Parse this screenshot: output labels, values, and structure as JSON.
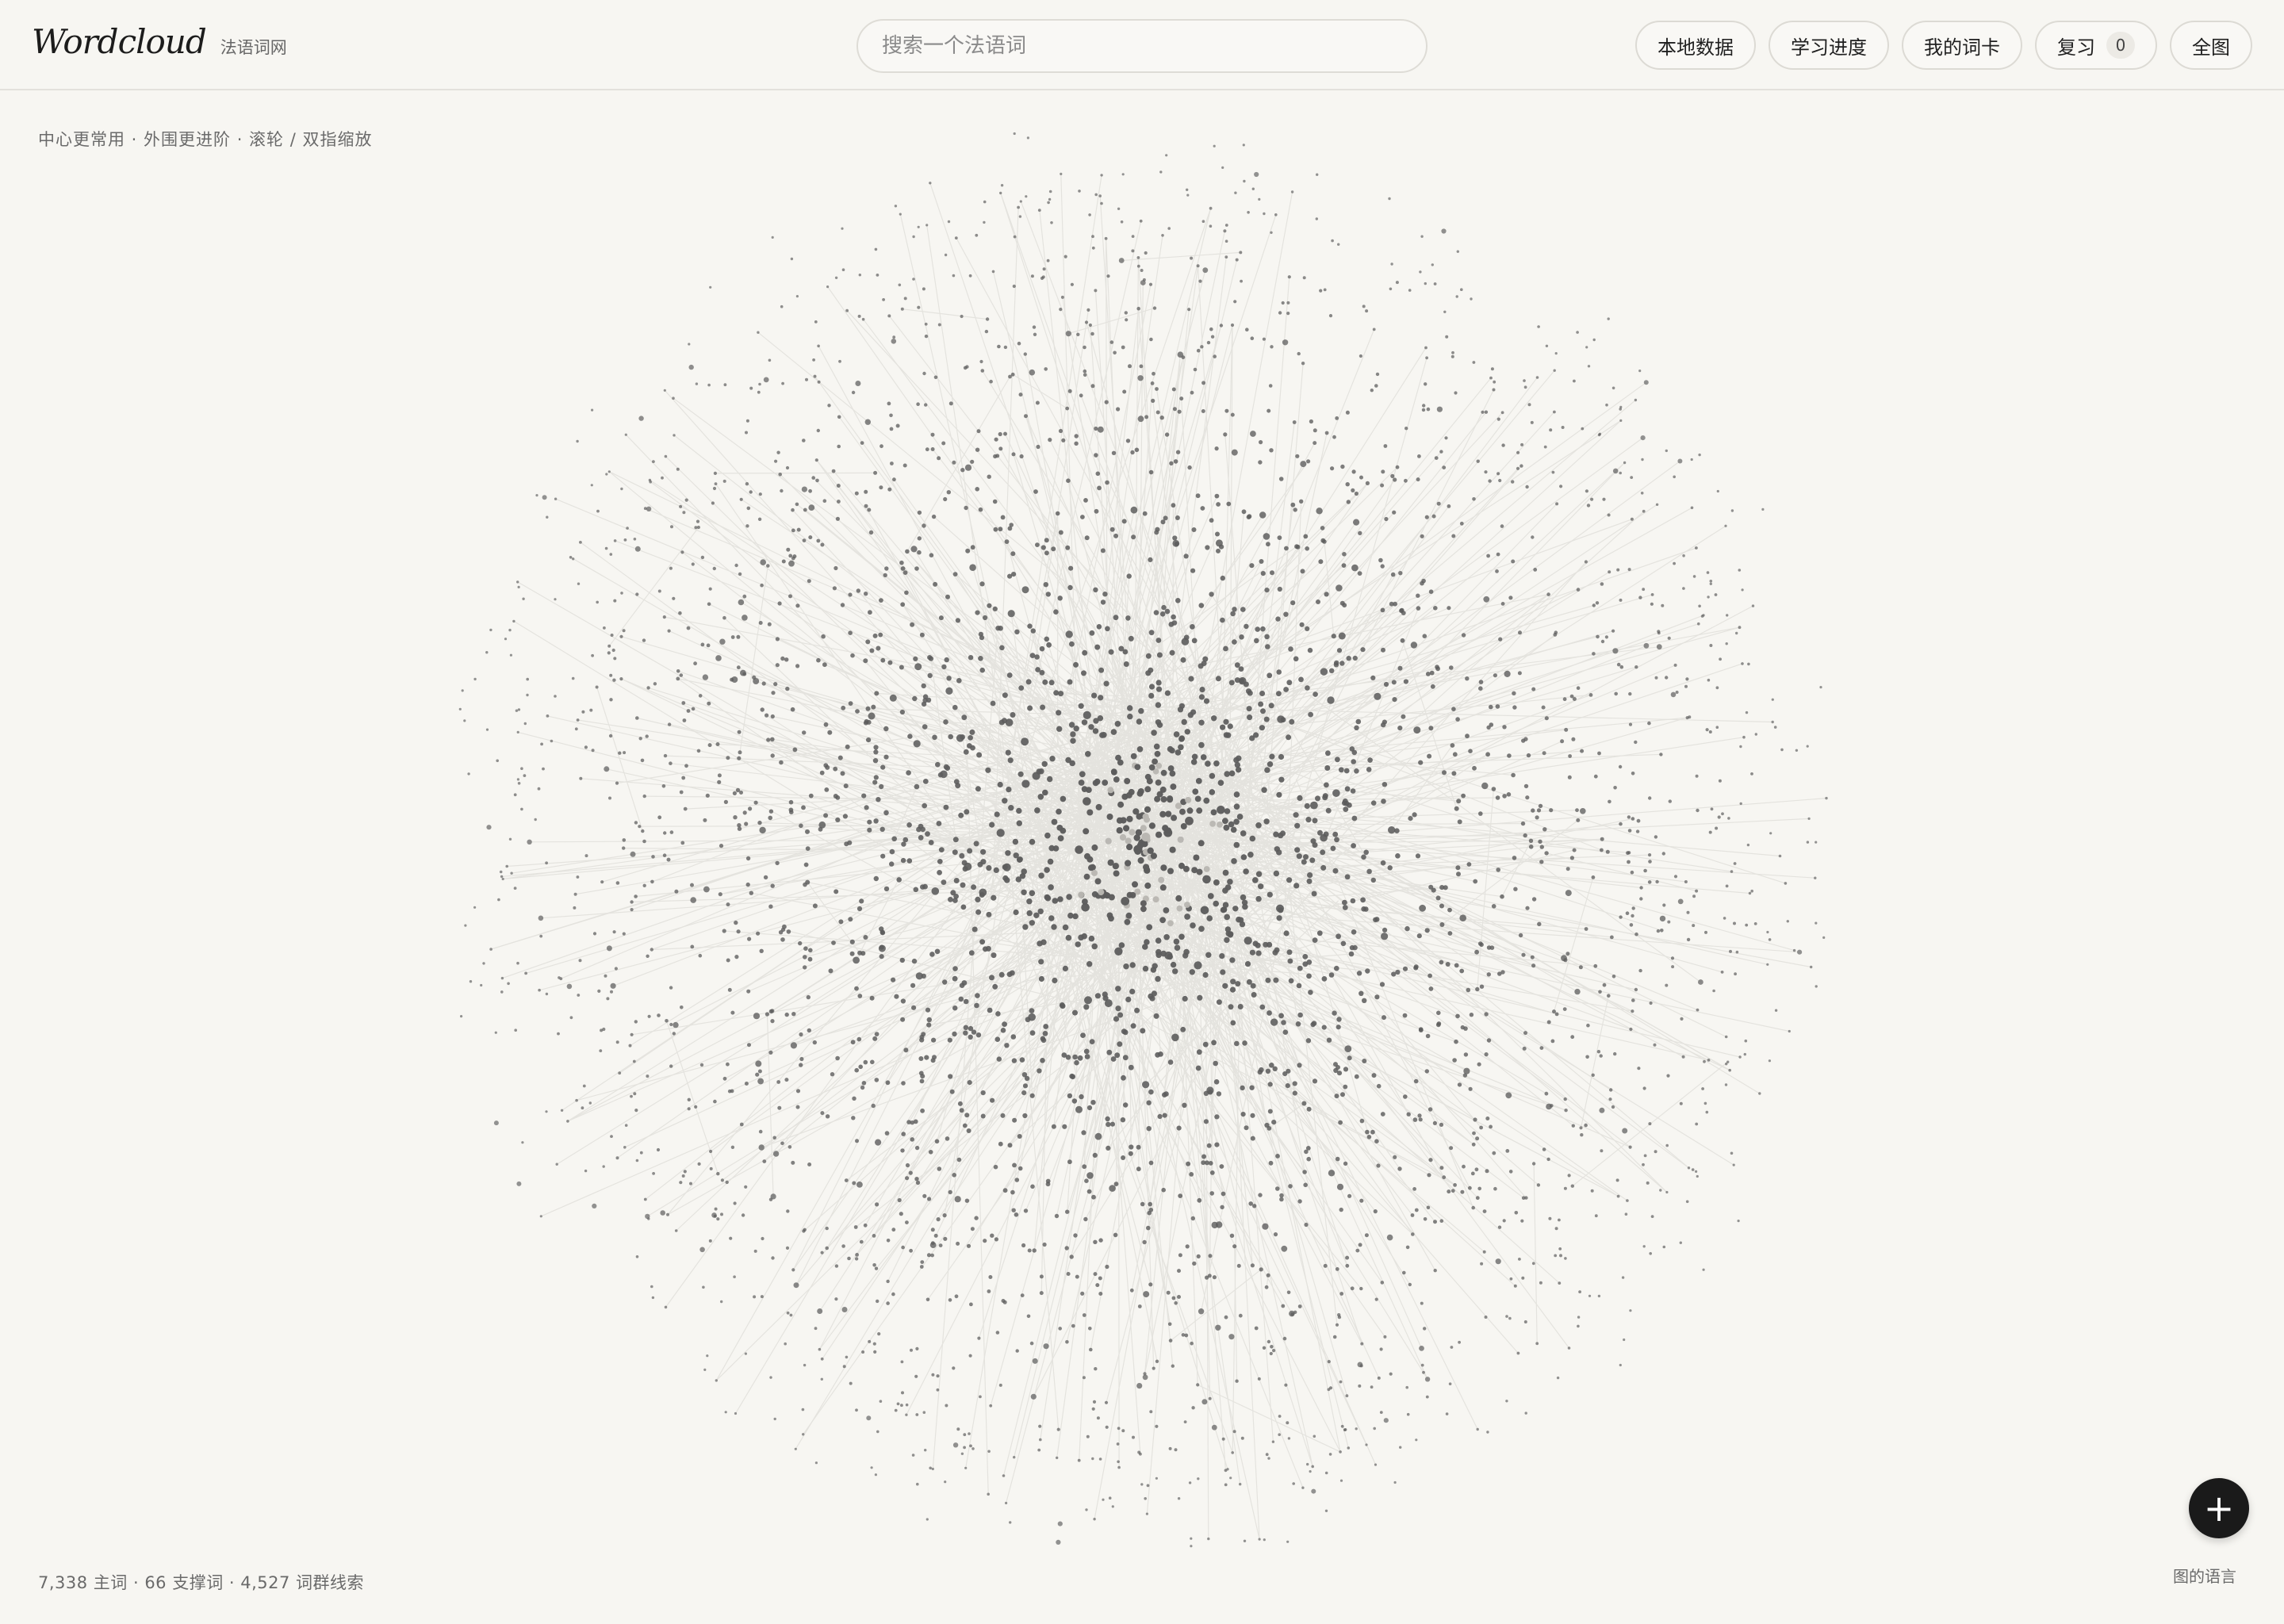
{
  "app": {
    "name": "Wordcloud",
    "subtitle": "法语词网"
  },
  "search": {
    "placeholder": "搜索一个法语词"
  },
  "nav": {
    "local_data": "本地数据",
    "progress": "学习进度",
    "my_cards": "我的词卡",
    "review": "复习",
    "review_count": "0",
    "full_graph": "全图"
  },
  "hint": "中心更常用 · 外围更进阶 · 滚轮 / 双指缩放",
  "stats": "7,338 主词 · 66 支撑词 · 4,527 词群线索",
  "fab": {
    "icon": "plus-icon",
    "label": "+"
  },
  "legend_link": "图的语言",
  "graph": {
    "node_color": "#5c5c5c",
    "edge_color": "#d6d4cf",
    "highlight_color": "#b9b7b2"
  }
}
